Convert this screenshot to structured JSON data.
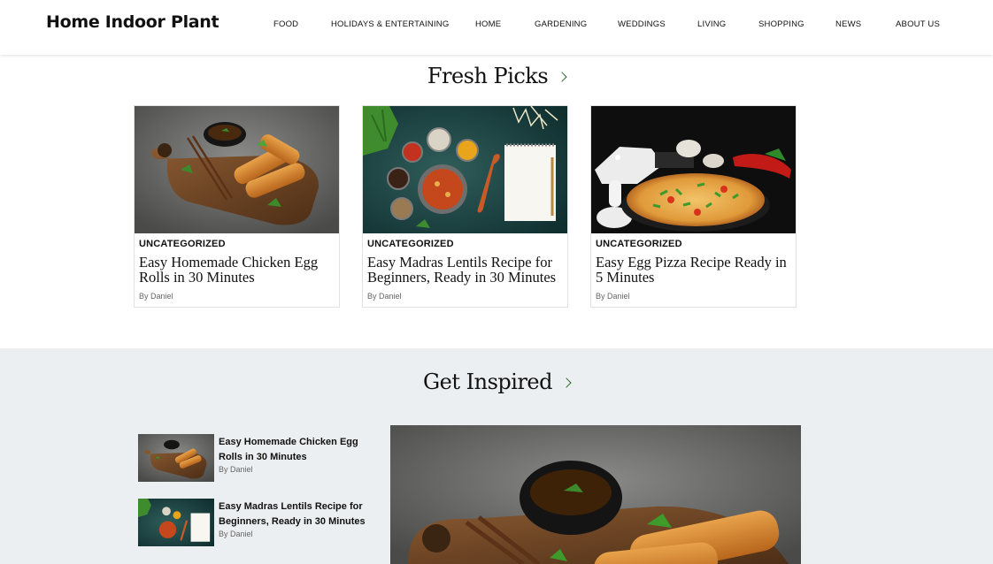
{
  "header": {
    "logo": "Home Indoor Plant",
    "nav": [
      {
        "label": "FOOD"
      },
      {
        "label": "HOLIDAYS & ENTERTAINING"
      },
      {
        "label": "HOME"
      },
      {
        "label": "GARDENING"
      },
      {
        "label": "WEDDINGS"
      },
      {
        "label": "LIVING"
      },
      {
        "label": "SHOPPING"
      },
      {
        "label": "NEWS"
      },
      {
        "label": "ABOUT US"
      }
    ]
  },
  "fresh_picks": {
    "title": "Fresh Picks",
    "cards": [
      {
        "category": "UNCATEGORIZED",
        "title": "Easy Homemade Chicken Egg Rolls in 30 Minutes",
        "byline": "By Daniel",
        "image": "egg-rolls-photo"
      },
      {
        "category": "UNCATEGORIZED",
        "title": "Easy Madras Lentils Recipe for Beginners, Ready in 30 Minutes",
        "byline": "By Daniel",
        "image": "lentils-photo"
      },
      {
        "category": "UNCATEGORIZED",
        "title": "Easy Egg Pizza Recipe Ready in 5 Minutes",
        "byline": "By Daniel",
        "image": "pizza-photo"
      }
    ]
  },
  "get_inspired": {
    "title": "Get Inspired",
    "items": [
      {
        "title": "Easy Homemade Chicken Egg Rolls in 30 Minutes",
        "byline": "By Daniel",
        "image": "egg-rolls-photo"
      },
      {
        "title": "Easy Madras Lentils Recipe for Beginners, Ready in 30 Minutes",
        "byline": "By Daniel",
        "image": "lentils-photo"
      }
    ],
    "feature_image": "egg-rolls-large-photo"
  },
  "colors": {
    "accent_green": "#2e6b2e",
    "inspired_bg": "#eceff1",
    "text": "#111111",
    "muted": "#666666"
  }
}
